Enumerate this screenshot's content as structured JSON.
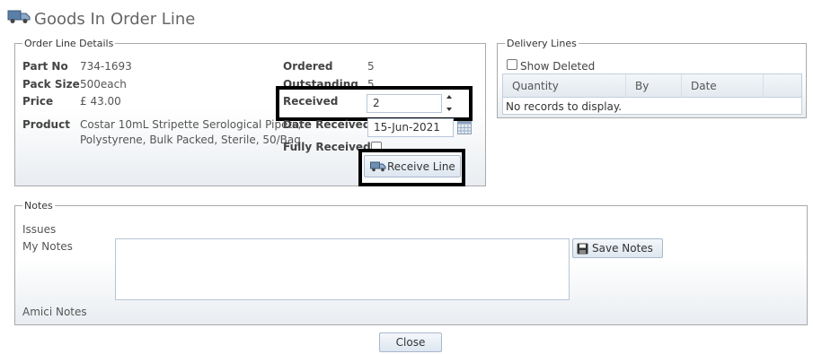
{
  "page": {
    "title": "Goods In Order Line"
  },
  "order_line": {
    "legend": "Order Line Details",
    "part_no_label": "Part No",
    "part_no": "734-1693",
    "pack_size_label": "Pack Size",
    "pack_size": "500each",
    "price_label": "Price",
    "price": "£ 43.00",
    "product_label": "Product",
    "product_line1": "Costar 10mL Stripette Serological Pipets,",
    "product_line2": "Polystyrene, Bulk Packed, Sterile, 50/Bag",
    "ordered_label": "Ordered",
    "ordered": "5",
    "outstanding_label": "Outstanding",
    "outstanding": "5",
    "received_label": "Received",
    "received": "2",
    "date_received_label": "Date Received",
    "date_received": "15-Jun-2021",
    "fully_received_label": "Fully Received",
    "receive_line_label": "Receive Line"
  },
  "delivery_lines": {
    "legend": "Delivery Lines",
    "show_deleted_label": "Show Deleted",
    "columns": [
      "Quantity",
      "By",
      "Date"
    ],
    "empty_text": "No records to display."
  },
  "notes": {
    "legend": "Notes",
    "issues_label": "Issues",
    "my_notes_label": "My Notes",
    "my_notes_value": "",
    "save_notes_label": "Save Notes",
    "amici_notes_label": "Amici Notes"
  },
  "footer": {
    "close_label": "Close"
  },
  "colors": {
    "highlight": "#000000",
    "grid_header": "#e3e9ef",
    "border": "#a9a9a9"
  }
}
